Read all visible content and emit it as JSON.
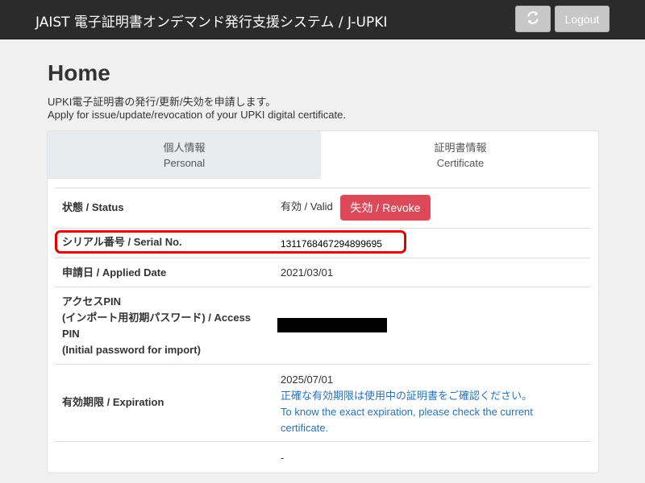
{
  "header": {
    "brand": "JAIST 電子証明書オンデマンド発行支援システム / J-UPKI",
    "refresh_icon": "refresh-icon",
    "logout_label": "Logout"
  },
  "page": {
    "title": "Home",
    "desc_ja": "UPKI電子証明書の発行/更新/失効を申請します。",
    "desc_en": "Apply for issue/update/revocation of your UPKI digital certificate."
  },
  "tabs": [
    {
      "label_ja": "個人情報",
      "label_en": "Personal",
      "active": false
    },
    {
      "label_ja": "証明書情報",
      "label_en": "Certificate",
      "active": true
    }
  ],
  "rows": {
    "status": {
      "label": "状態 / Status",
      "value": "有効 / Valid",
      "button": "失効 / Revoke"
    },
    "serial": {
      "label": "シリアル番号 / Serial No.",
      "value": "1311768467294899695"
    },
    "applied": {
      "label": "申請日 / Applied Date",
      "value": "2021/03/01"
    },
    "pin": {
      "label_line1": "アクセスPIN",
      "label_line2": "(インポート用初期パスワード) / Access",
      "label_line3": "PIN",
      "label_line4": "(Initial password for import)"
    },
    "expiration": {
      "label": "有効期限 / Expiration",
      "date": "2025/07/01",
      "note_ja": "正確な有効期限は使用中の証明書をご確認ください。",
      "note_en1": "To know the exact expiration, please check the current",
      "note_en2": "certificate."
    },
    "last": {
      "value": "-"
    }
  },
  "colors": {
    "navbar": "#2b2b2b",
    "revoke": "#dc4a5a",
    "highlight": "#e00000",
    "note": "#2a73b8"
  }
}
